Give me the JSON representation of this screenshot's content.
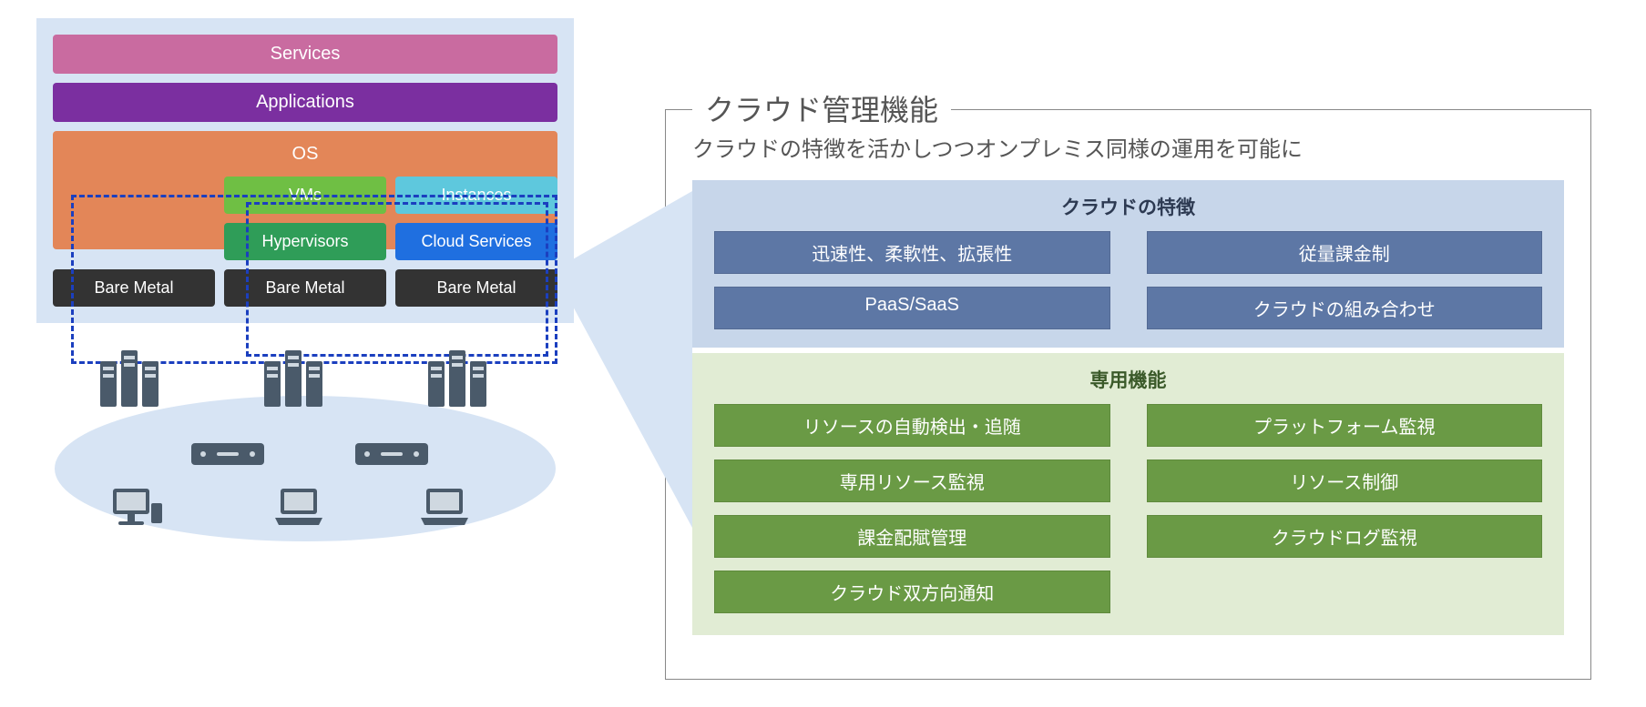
{
  "left": {
    "layers": {
      "services": "Services",
      "applications": "Applications",
      "os": "OS"
    },
    "grid": {
      "vms": "VMs",
      "instances": "Instances",
      "hypervisors": "Hypervisors",
      "cloud_services": "Cloud Services",
      "bare_metal": "Bare Metal"
    }
  },
  "right": {
    "title": "クラウド管理機能",
    "subtitle": "クラウドの特徴を活かしつつオンプレミス同様の運用を可能に",
    "features": {
      "heading": "クラウドの特徴",
      "items": [
        "迅速性、柔軟性、拡張性",
        "従量課金制",
        "PaaS/SaaS",
        "クラウドの組み合わせ"
      ]
    },
    "functions": {
      "heading": "専用機能",
      "items": [
        "リソースの自動検出・追随",
        "プラットフォーム監視",
        "専用リソース監視",
        "リソース制御",
        "課金配賦管理",
        "クラウドログ監視",
        "クラウド双方向通知"
      ]
    }
  }
}
